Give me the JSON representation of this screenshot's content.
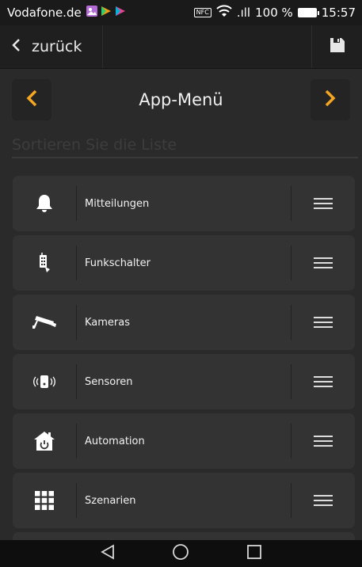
{
  "statusbar": {
    "carrier": "Vodafone.de",
    "nfc": "NFC",
    "signal": ".ıll",
    "battery": "100 %",
    "time": "15:57"
  },
  "appbar": {
    "back_label": "zurück",
    "save_icon": "save-icon"
  },
  "menu": {
    "title": "App-Menü",
    "sort_hint": "Sortieren Sie die Liste",
    "accent_color": "#f5a623"
  },
  "items": [
    {
      "label": "Mitteilungen",
      "icon": "bell-icon"
    },
    {
      "label": "Funkschalter",
      "icon": "remote-icon"
    },
    {
      "label": "Kameras",
      "icon": "camera-icon"
    },
    {
      "label": "Sensoren",
      "icon": "sensor-icon"
    },
    {
      "label": "Automation",
      "icon": "home-power-icon"
    },
    {
      "label": "Szenarien",
      "icon": "grid-icon"
    }
  ]
}
